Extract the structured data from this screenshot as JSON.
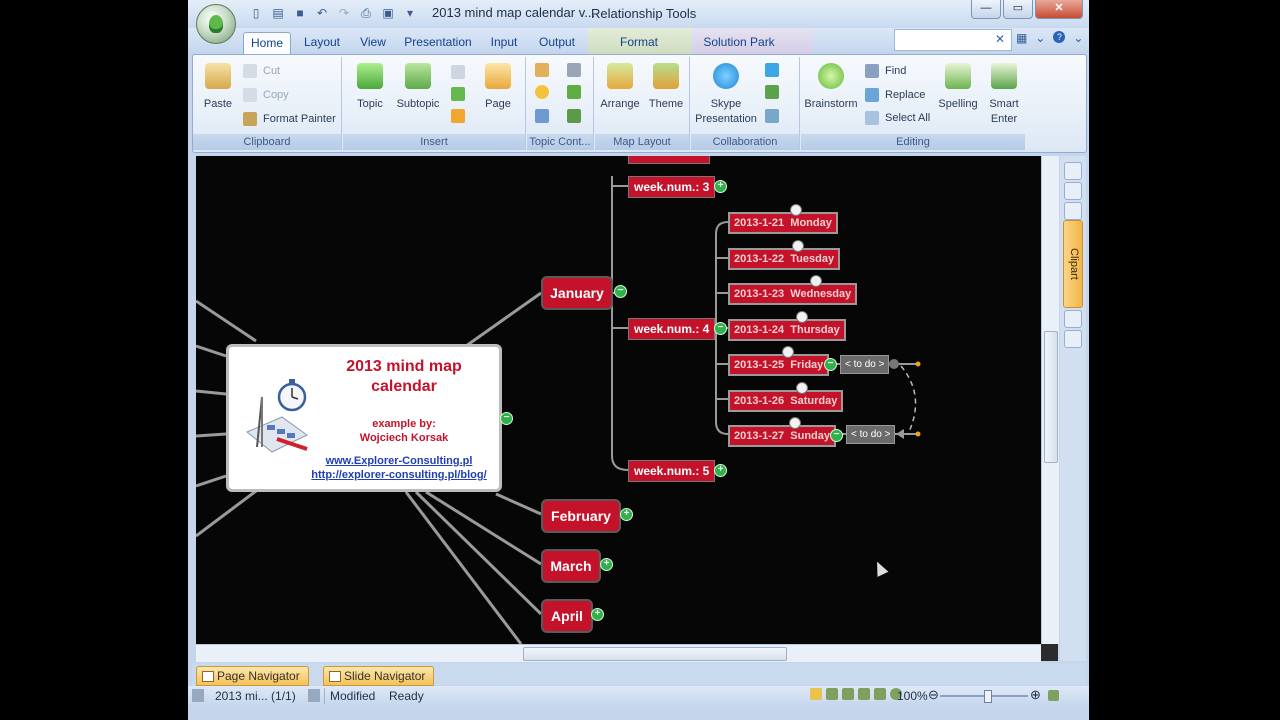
{
  "window": {
    "title": "2013 mind map calendar v...",
    "context_tab_group": "Relationship Tools"
  },
  "tabs": [
    "Home",
    "Layout",
    "View",
    "Presentation",
    "Input",
    "Output",
    "Format",
    "Solution Park"
  ],
  "ribbon": {
    "clipboard": {
      "paste": "Paste",
      "cut": "Cut",
      "copy": "Copy",
      "format_painter": "Format Painter",
      "label": "Clipboard"
    },
    "insert": {
      "topic": "Topic",
      "subtopic": "Subtopic",
      "page": "Page",
      "label": "Insert"
    },
    "topic_content": {
      "label": "Topic Cont..."
    },
    "map_layout": {
      "arrange": "Arrange",
      "theme": "Theme",
      "label": "Map Layout"
    },
    "collaboration": {
      "skype": "Skype",
      "presentation": "Presentation",
      "label": "Collaboration"
    },
    "editing": {
      "brainstorm": "Brainstorm",
      "find": "Find",
      "replace": "Replace",
      "select_all": "Select All",
      "spelling": "Spelling",
      "smart": "Smart",
      "enter": "Enter",
      "label": "Editing"
    }
  },
  "side_panel": {
    "clipart": "Clipart"
  },
  "map": {
    "central": {
      "title_line1": "2013 mind map",
      "title_line2": "calendar",
      "example_by": "example by:",
      "author": "Wojciech Korsak",
      "link1": "www.Explorer-Consulting.pl",
      "link2": "http://explorer-consulting.pl/blog/"
    },
    "months": [
      "January",
      "February",
      "March",
      "April"
    ],
    "weeks": [
      "week.num.: 3",
      "week.num.: 4",
      "week.num.: 5"
    ],
    "days": [
      {
        "date": "2013-1-21",
        "name": "Monday"
      },
      {
        "date": "2013-1-22",
        "name": "Tuesday"
      },
      {
        "date": "2013-1-23",
        "name": "Wednesday"
      },
      {
        "date": "2013-1-24",
        "name": "Thursday"
      },
      {
        "date": "2013-1-25",
        "name": "Friday"
      },
      {
        "date": "2013-1-26",
        "name": "Saturday"
      },
      {
        "date": "2013-1-27",
        "name": "Sunday"
      }
    ],
    "todo_label": "< to do >"
  },
  "navigators": {
    "page": "Page Navigator",
    "slide": "Slide Navigator"
  },
  "status": {
    "page_info": "2013 mi... (1/1)",
    "modified": "Modified",
    "ready": "Ready",
    "zoom": "100%"
  },
  "colors": {
    "node_red": "#c4122b",
    "canvas_bg": "#060606",
    "link_blue": "#1f3fb5"
  }
}
